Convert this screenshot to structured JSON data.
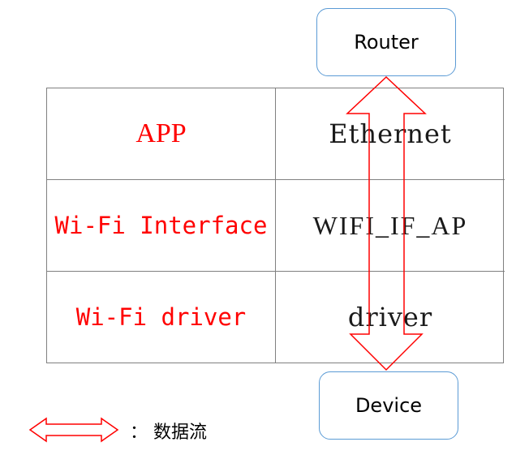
{
  "nodes": {
    "router": "Router",
    "device": "Device"
  },
  "table": {
    "rows": [
      {
        "left": "APP",
        "right": "Ethernet"
      },
      {
        "left": "Wi-Fi Interface",
        "right": "WIFI_IF_AP"
      },
      {
        "left": "Wi-Fi driver",
        "right": "driver"
      }
    ]
  },
  "legend": {
    "label": "： 数据流"
  },
  "colors": {
    "node_border": "#5b9bd5",
    "arrow": "#ff0000",
    "left_text": "#ff0000",
    "right_text": "#1a1a1a",
    "grid": "#808080"
  }
}
